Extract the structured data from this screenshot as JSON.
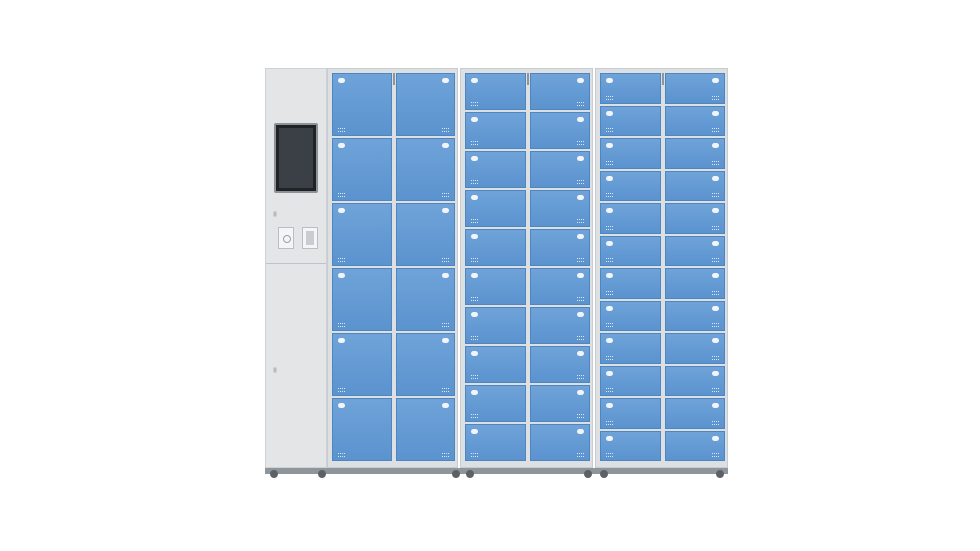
{
  "image": {
    "subject": "",
    "colors": {
      "door_blue": "#6fa3d9",
      "frame_grey": "#dde0e3",
      "screen": "#1f2326"
    },
    "control_panel": {
      "screen_icon": "touchscreen-icon",
      "reader_left_icon": "rfid-reader-icon",
      "reader_right_icon": "scanner-icon"
    },
    "cabinets": [
      {
        "columns": [
          6,
          6
        ]
      },
      {
        "columns": [
          10,
          10
        ]
      },
      {
        "columns": [
          12,
          12
        ]
      }
    ]
  }
}
